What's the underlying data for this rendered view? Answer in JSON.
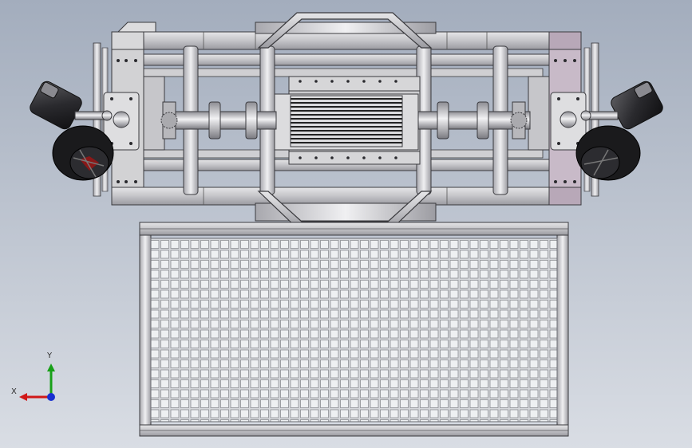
{
  "view": {
    "background_top": "#a3adbd",
    "background_bottom": "#d9dde4"
  },
  "triad": {
    "x_label": "X",
    "y_label": "Y",
    "x_color": "#d01818",
    "y_color": "#18a018",
    "z_color": "#1830d0"
  },
  "model": {
    "frame_color": "#c9c9cc",
    "edge_color": "#3a3a3e",
    "motor_color": "#1a1a1c",
    "accent_color": "#b09ab0"
  }
}
